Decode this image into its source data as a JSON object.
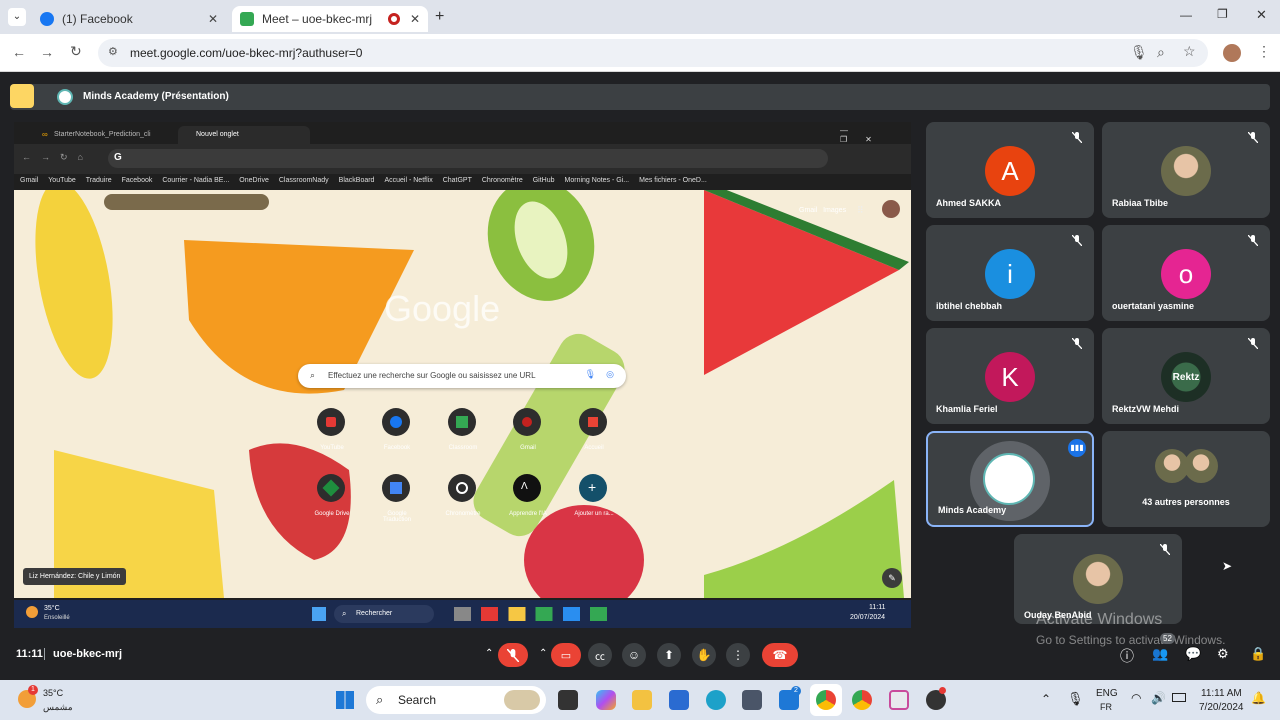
{
  "browser": {
    "tabs": [
      {
        "label": "(1) Facebook",
        "color": "#1877f2"
      },
      {
        "label": "Meet – uoe-bkec-mrj",
        "color": "#34a853"
      }
    ],
    "url": "meet.google.com/uoe-bkec-mrj?authuser=0"
  },
  "meet": {
    "presentation_title": "Minds Academy (Présentation)",
    "time": "11:11",
    "meeting_code": "uoe-bkec-mrj",
    "participants_count": "52"
  },
  "shared": {
    "tabs": [
      "StarterNotebook_Prediction_cli",
      "Nouvel onglet"
    ],
    "bookmarks": [
      "Gmail",
      "YouTube",
      "Traduire",
      "Facebook",
      "Courrier - Nadia BE...",
      "OneDrive",
      "ClassroomNady",
      "BlackBoard",
      "Accueil - Netflix",
      "ChatGPT",
      "Chronomètre",
      "GitHub",
      "Morning Notes - Gi...",
      "Mes fichiers - OneD..."
    ],
    "search_placeholder": "Effectuez une recherche sur Google ou saisissez une URL",
    "logo": "Google",
    "top_links": "Gmail   Images",
    "shortcuts_row1": [
      "YouTube",
      "Facebook",
      "Classroom",
      "Gmail",
      "Accueil"
    ],
    "shortcuts_row2": [
      "Google Drive",
      "Google Traduction",
      "Chronomètre",
      "Apprendre l'IA",
      "Ajouter un ra..."
    ],
    "caption": "Liz Hernández: Chile y Limón",
    "taskbar": {
      "weather_temp": "35°C",
      "weather_desc": "Ensoleillé",
      "search": "Rechercher",
      "time": "11:11",
      "date": "20/07/2024"
    }
  },
  "participants": [
    {
      "name": "Ahmed SAKKA",
      "initial": "A",
      "color": "#e8430f"
    },
    {
      "name": "Rabiaa Tbibe",
      "initial": "",
      "color": "#7a8b5c"
    },
    {
      "name": "ibtihel chebbah",
      "initial": "i",
      "color": "#1a8fe0"
    },
    {
      "name": "ouertatani yasmine",
      "initial": "o",
      "color": "#e52592"
    },
    {
      "name": "Khamlia Feriel",
      "initial": "K",
      "color": "#c2185b"
    },
    {
      "name": "RektzVW Mehdi",
      "initial": "",
      "color": "#2e4a3a"
    },
    {
      "name": "Minds Academy",
      "initial": "",
      "color": "#ffffff"
    },
    {
      "name": "43 autres personnes",
      "initial": "",
      "color": "#3c4043"
    },
    {
      "name": "Ouday BenAbid",
      "initial": "",
      "color": "#3c4043"
    }
  ],
  "watermark": {
    "line1": "Activate Windows",
    "line2": "Go to Settings to activate Windows."
  },
  "taskbar": {
    "weather_temp": "35°C",
    "weather_desc": "مشمس",
    "search": "Search",
    "lang": "ENG",
    "lang_sub": "FR",
    "time": "11:11 AM",
    "date": "7/20/2024"
  }
}
